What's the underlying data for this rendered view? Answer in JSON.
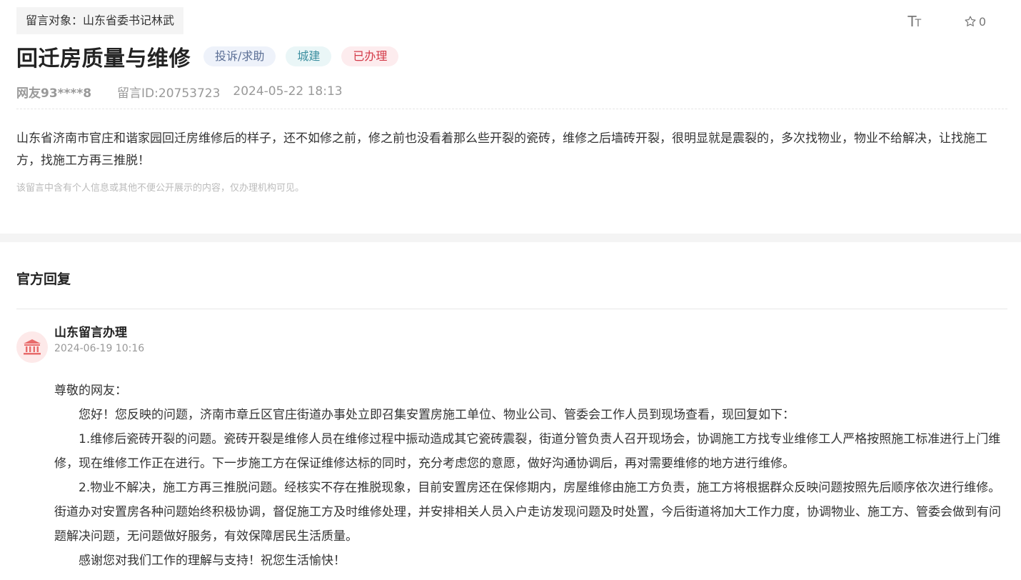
{
  "message": {
    "target_tag": "留言对象：山东省委书记林武",
    "title": "回迁房质量与维修",
    "tags": {
      "type": "投诉/求助",
      "category": "城建",
      "status": "已办理"
    },
    "user": "网友93****8",
    "message_id": "留言ID:20753723",
    "datetime": "2024-05-22 18:13",
    "content": "山东省济南市官庄和谐家园回迁房维修后的样子，还不如修之前，修之前也没看着那么些开裂的瓷砖，维修之后墙砖开裂，很明显就是震裂的，多次找物业，物业不给解决，让找施工方，找施工方再三推脱！",
    "notice": "该留言中含有个人信息或其他不便公开展示的内容，仅办理机构可见。"
  },
  "toolbar": {
    "font_size_label": "TT",
    "font_size_icon": "font-size-icon",
    "star_icon": "star-icon",
    "star_count": "0"
  },
  "reply": {
    "heading": "官方回复",
    "org_icon": "government-building-icon",
    "org_name": "山东留言办理",
    "date": "2024-06-19 10:16",
    "greeting": "尊敬的网友：",
    "paragraphs": [
      "您好！您反映的问题，济南市章丘区官庄街道办事处立即召集安置房施工单位、物业公司、管委会工作人员到现场查看，现回复如下：",
      "1.维修后瓷砖开裂的问题。瓷砖开裂是维修人员在维修过程中振动造成其它瓷砖震裂，街道分管负责人召开现场会，协调施工方找专业维修工人严格按照施工标准进行上门维修，现在维修工作正在进行。下一步施工方在保证维修达标的同时，充分考虑您的意愿，做好沟通协调后，再对需要维修的地方进行维修。",
      "2.物业不解决，施工方再三推脱问题。经核实不存在推脱现象，目前安置房还在保修期内，房屋维修由施工方负责，施工方将根据群众反映问题按照先后顺序依次进行维修。街道办对安置房各种问题始终积极协调，督促施工方及时维修处理，并安排相关人员入户走访发现问题及时处置，今后街道将加大工作力度，协调物业、施工方、管委会做到有问题解决问题，无问题做好服务，有效保障居民生活质量。",
      "感谢您对我们工作的理解与支持！祝您生活愉快！"
    ]
  },
  "colors": {
    "status_red": "#d33a48",
    "category_teal": "#3c8fa0",
    "type_blue": "#5b6f95",
    "avatar_bg": "#fde9e9",
    "avatar_icon": "#e86b6b"
  }
}
